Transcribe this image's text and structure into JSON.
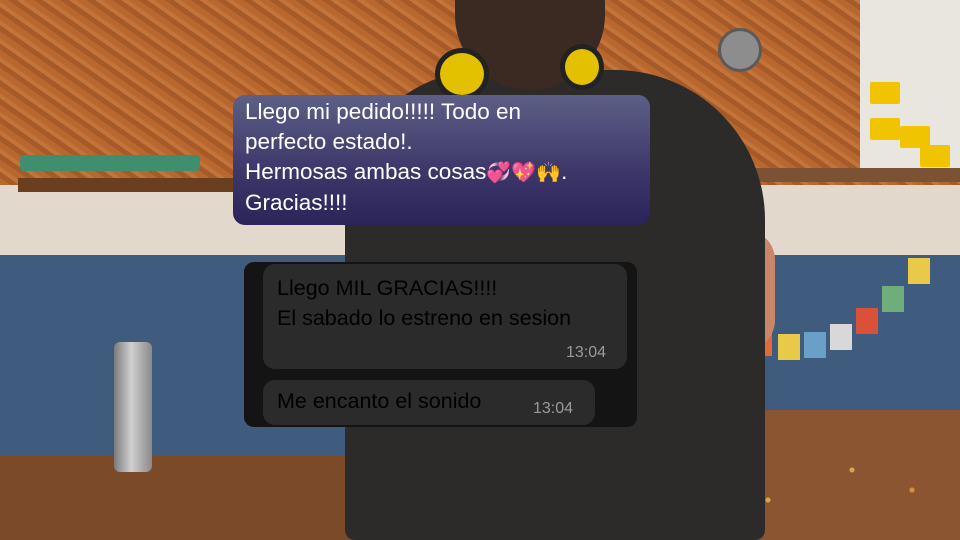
{
  "sent_message": {
    "line1": "Llego mi pedido!!!!! Todo en",
    "line2": "perfecto estado!.",
    "line3": "Hermosas ambas cosas",
    "line3_end": ".",
    "line4": "Gracias!!!!",
    "emojis": [
      "💞",
      "💖",
      "🙌"
    ],
    "emoji_names": [
      "two-hearts-icon",
      "sparkling-heart-icon",
      "raised-hands-icon"
    ]
  },
  "received_messages": [
    {
      "text": "Llego MIL GRACIAS!!!!\nEl sabado lo estreno en sesion",
      "time": "13:04"
    },
    {
      "text": "Me encanto el sonido",
      "time": "13:04"
    }
  ],
  "colors": {
    "sent_bubble": "#3d3669",
    "received_bubble": "#2b2b2b",
    "received_panel": "#141414",
    "timestamp": "#9a9a9a"
  }
}
